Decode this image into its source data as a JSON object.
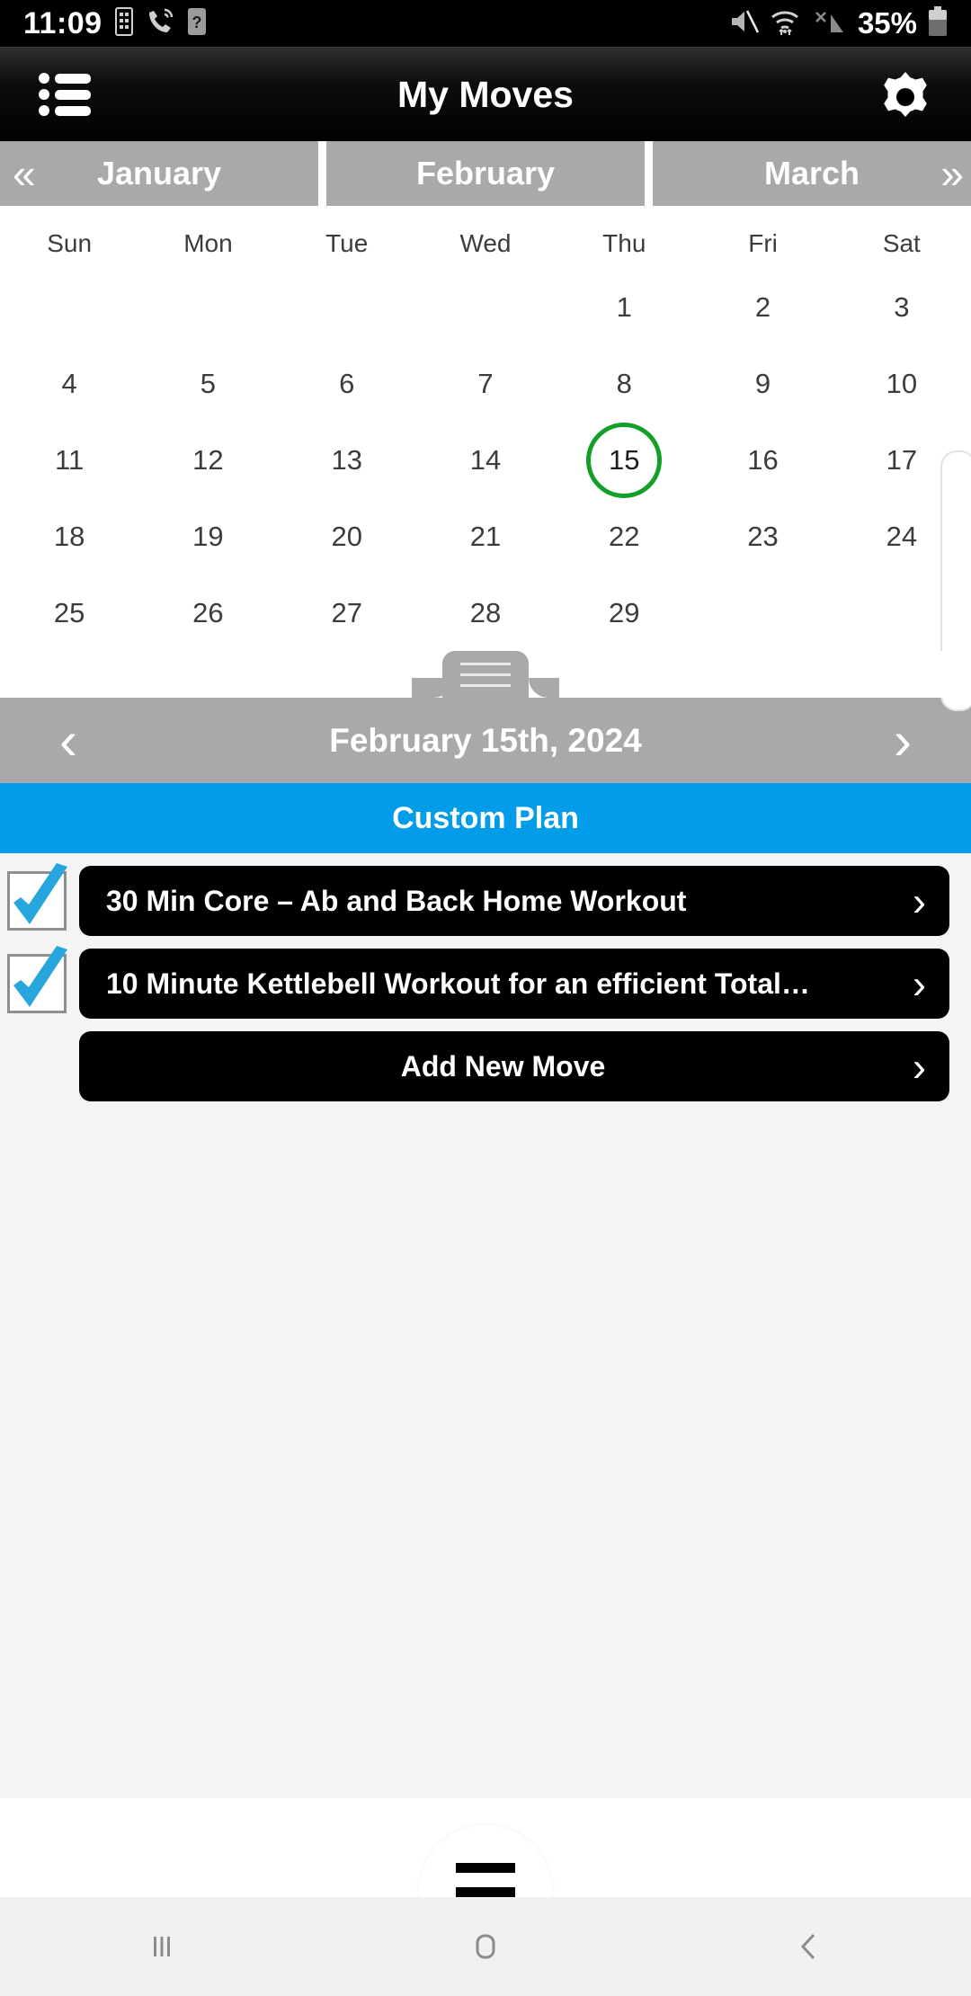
{
  "status_bar": {
    "time": "11:09",
    "battery_percent": "35%",
    "icons": [
      "sim-card-icon",
      "call-wifi-icon",
      "unknown-sim-icon",
      "mute-icon",
      "wifi-icon",
      "no-signal-icon",
      "battery-icon"
    ]
  },
  "app_bar": {
    "title": "My Moves",
    "menu_icon": "list-menu-icon",
    "settings_icon": "gear-icon"
  },
  "month_tabs": [
    {
      "label": "January",
      "arrow": "«",
      "arrow_side": "prev"
    },
    {
      "label": "February",
      "arrow": "",
      "arrow_side": ""
    },
    {
      "label": "March",
      "arrow": "»",
      "arrow_side": "next"
    }
  ],
  "calendar": {
    "weekdays": [
      "Sun",
      "Mon",
      "Tue",
      "Wed",
      "Thu",
      "Fri",
      "Sat"
    ],
    "weeks": [
      [
        "",
        "",
        "",
        "",
        "1",
        "2",
        "3"
      ],
      [
        "4",
        "5",
        "6",
        "7",
        "8",
        "9",
        "10"
      ],
      [
        "11",
        "12",
        "13",
        "14",
        "15",
        "16",
        "17"
      ],
      [
        "18",
        "19",
        "20",
        "21",
        "22",
        "23",
        "24"
      ],
      [
        "25",
        "26",
        "27",
        "28",
        "29",
        "",
        ""
      ]
    ],
    "selected_day": "15",
    "selected_color": "#12a028"
  },
  "date_nav": {
    "prev": "‹",
    "label": "February 15th, 2024",
    "next": "›"
  },
  "plan_banner": {
    "label": "Custom Plan",
    "color": "#039ce8"
  },
  "moves": [
    {
      "label": "30 Min Core – Ab and Back Home Workout",
      "checked": true,
      "chevron": "›"
    },
    {
      "label": "10 Minute Kettlebell Workout for an efficient Total…",
      "checked": true,
      "chevron": "›"
    }
  ],
  "add_move": {
    "label": "Add New Move",
    "chevron": "›"
  },
  "fab": {
    "icon": "hamburger-menu-icon"
  },
  "android_nav": {
    "recents": "recents-icon",
    "home": "home-icon",
    "back": "back-icon"
  }
}
